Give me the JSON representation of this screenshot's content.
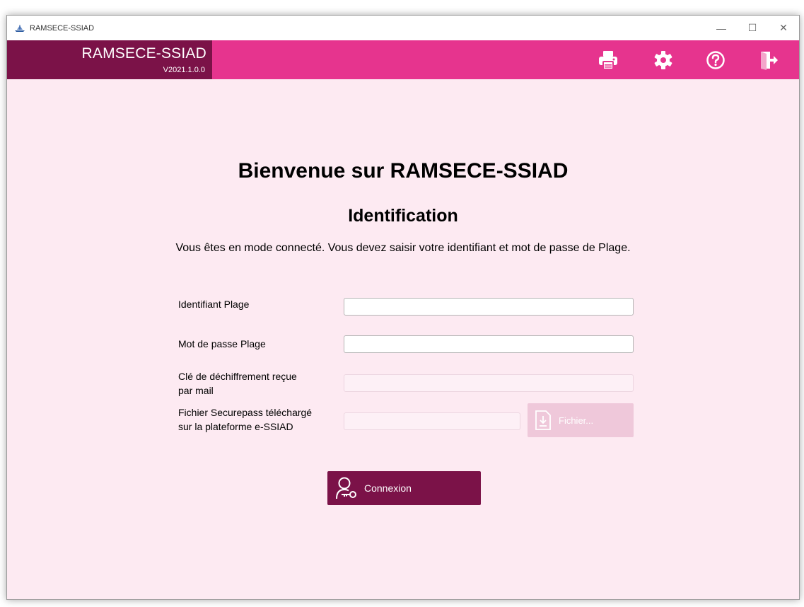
{
  "window": {
    "title": "RAMSECE-SSIAD",
    "controls": {
      "minimize": "—",
      "maximize": "☐",
      "close": "✕"
    }
  },
  "header": {
    "app_name": "RAMSECE-SSIAD",
    "version": "V2021.1.0.0",
    "icons": [
      "printer-icon",
      "gear-icon",
      "help-icon",
      "exit-icon"
    ],
    "colors": {
      "bar": "#e6348e",
      "brand": "#7b1248"
    }
  },
  "main": {
    "welcome": "Bienvenue sur RAMSECE-SSIAD",
    "subtitle": "Identification",
    "instruction": "Vous êtes en mode connecté. Vous devez saisir votre identifiant et mot de passe de Plage."
  },
  "form": {
    "identifiant_label": "Identifiant Plage",
    "identifiant_value": "",
    "password_label": "Mot de passe Plage",
    "password_value": "",
    "key_label_line1": "Clé de déchiffrement reçue",
    "key_label_line2": "par mail",
    "key_value": "",
    "file_label_line1": "Fichier Securepass téléchargé",
    "file_label_line2": "sur la plateforme e-SSIAD",
    "file_value": "",
    "file_button": "Fichier...",
    "connect_button": "Connexion"
  }
}
